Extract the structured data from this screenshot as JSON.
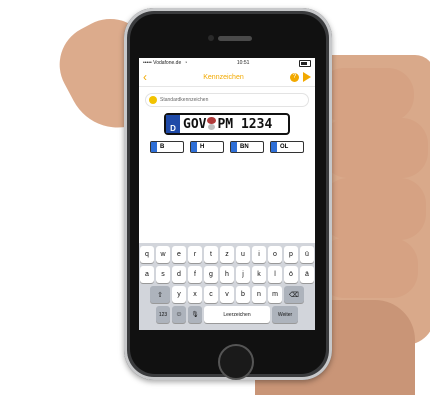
{
  "status_bar": {
    "carrier": "••••• Vodafone.de",
    "wifi": "wifi-icon",
    "time": "10:51",
    "battery_pct": ""
  },
  "nav": {
    "back_icon": "chevron-left-icon",
    "title": "Kennzeichen",
    "help_icon": "help-icon",
    "send_icon": "play-icon"
  },
  "plate_type": {
    "label": "Standardkennzeichen"
  },
  "plate": {
    "country": "D",
    "left": "GOV",
    "right": "PM 1234"
  },
  "quick_plates": [
    {
      "label": "B"
    },
    {
      "label": "H"
    },
    {
      "label": "BN"
    },
    {
      "label": "OL"
    }
  ],
  "keyboard": {
    "row1": [
      "q",
      "w",
      "e",
      "r",
      "t",
      "z",
      "u",
      "i",
      "o",
      "p",
      "ü"
    ],
    "row2": [
      "a",
      "s",
      "d",
      "f",
      "g",
      "h",
      "j",
      "k",
      "l",
      "ö",
      "ä"
    ],
    "row3": [
      "y",
      "x",
      "c",
      "v",
      "b",
      "n",
      "m"
    ],
    "shift": "⇧",
    "delete": "⌫",
    "numbers": "123",
    "emoji": "☺",
    "mic": "🎙",
    "space": "Leerzeichen",
    "return": "Weiter"
  },
  "colors": {
    "accent": "#f2a900",
    "eu_blue": "#1f4aa8"
  }
}
